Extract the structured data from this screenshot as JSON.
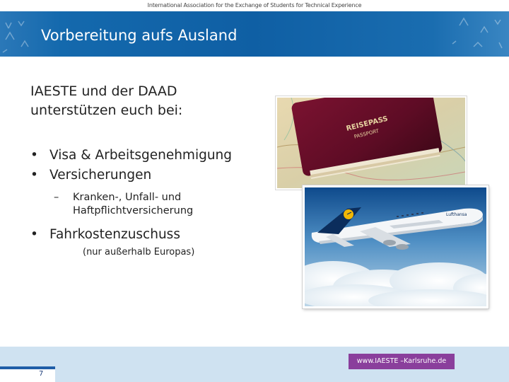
{
  "header": {
    "organization": "International Association for the Exchange of Students for Technical Experience",
    "title": "Vorbereitung aufs Ausland"
  },
  "content": {
    "intro_line1": "IAESTE und der DAAD",
    "intro_line2": "unterstützen euch bei:",
    "bullets": [
      {
        "text": "Visa & Arbeitsgenehmigung"
      },
      {
        "text": "Versicherungen"
      },
      {
        "text": "Fahrkostenzuschuss"
      }
    ],
    "sub_bullet_line1": "Kranken-, Unfall- und",
    "sub_bullet_line2": "Haftpflichtversicherung",
    "note": "(nur außerhalb Europas)",
    "bullet_symbol": "•",
    "dash_symbol": "–"
  },
  "images": {
    "passport_text1": "REISEPASS",
    "passport_text2": "PASSPORT",
    "plane_livery": "Lufthansa"
  },
  "footer": {
    "url": "www.IAESTE –Karlsruhe.de",
    "page_number": "7",
    "url_bg_color": "#8a3f9c",
    "band_color": "#cfe2f1"
  }
}
